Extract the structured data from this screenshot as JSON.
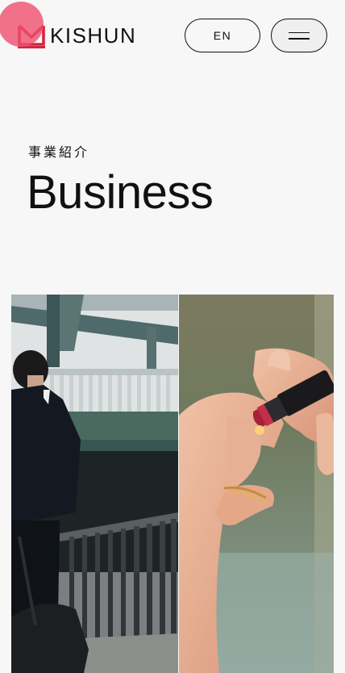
{
  "header": {
    "brand_name": "KISHUN",
    "lang_label": "EN",
    "menu_icon": "hamburger-menu-icon",
    "logo_icon": "kishun-envelope-logo-icon"
  },
  "hero": {
    "eyebrow": "事業紹介",
    "title": "Business"
  },
  "images": [
    {
      "name": "business-photo-bridge-walker"
    },
    {
      "name": "business-photo-lipstick-hands"
    }
  ],
  "colors": {
    "brand_red": "#d4253f",
    "background": "#f7f7f7",
    "text": "#111111",
    "tap_indicator": "#ed4f6d"
  }
}
